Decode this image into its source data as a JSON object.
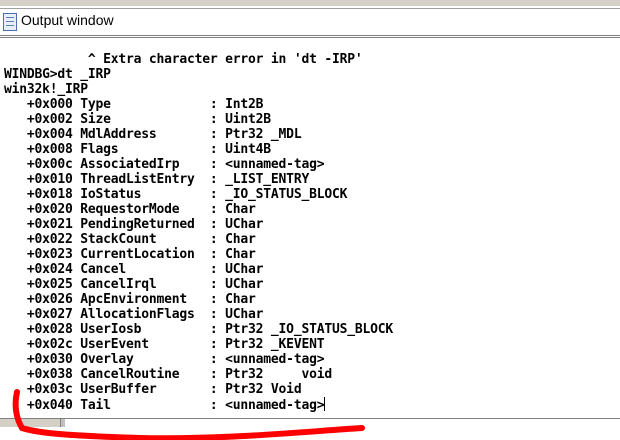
{
  "window": {
    "title": "Output window",
    "icon": "document-window-icon"
  },
  "output": {
    "lines": [
      "           ^ Extra character error in 'dt -IRP'",
      "WINDBG>dt _IRP",
      "win32k!_IRP",
      "   +0x000 Type             : Int2B",
      "   +0x002 Size             : Uint2B",
      "   +0x004 MdlAddress       : Ptr32 _MDL",
      "   +0x008 Flags            : Uint4B",
      "   +0x00c AssociatedIrp    : <unnamed-tag>",
      "   +0x010 ThreadListEntry  : _LIST_ENTRY",
      "   +0x018 IoStatus         : _IO_STATUS_BLOCK",
      "   +0x020 RequestorMode    : Char",
      "   +0x021 PendingReturned  : UChar",
      "   +0x022 StackCount       : Char",
      "   +0x023 CurrentLocation  : Char",
      "   +0x024 Cancel           : UChar",
      "   +0x025 CancelIrql       : UChar",
      "   +0x026 ApcEnvironment   : Char",
      "   +0x027 AllocationFlags  : UChar",
      "   +0x028 UserIosb         : Ptr32 _IO_STATUS_BLOCK",
      "   +0x02c UserEvent        : Ptr32 _KEVENT",
      "   +0x030 Overlay          : <unnamed-tag>",
      "   +0x038 CancelRoutine    : Ptr32     void",
      "   +0x03c UserBuffer       : Ptr32 Void",
      "   +0x040 Tail             : <unnamed-tag>"
    ]
  },
  "annotation": {
    "color": "#ff0000"
  }
}
